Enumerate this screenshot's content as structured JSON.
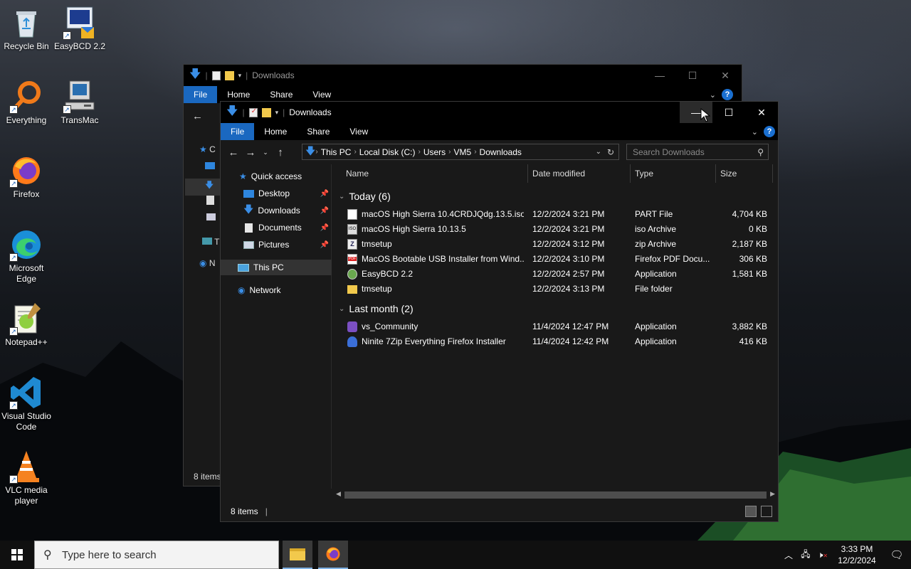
{
  "desktop": {
    "icons": [
      {
        "label": "Recycle Bin"
      },
      {
        "label": "EasyBCD 2.2"
      },
      {
        "label": "Everything"
      },
      {
        "label": "TransMac"
      },
      {
        "label": "Firefox"
      },
      {
        "label": "Microsoft Edge"
      },
      {
        "label": "Notepad++"
      },
      {
        "label": "Visual Studio Code"
      },
      {
        "label": "VLC media player"
      }
    ]
  },
  "back_window": {
    "title": "Downloads",
    "ribbon": {
      "file": "File",
      "home": "Home",
      "share": "Share",
      "view": "View"
    },
    "status": "8 items",
    "nav_peek": [
      "C",
      "T",
      "N"
    ]
  },
  "window": {
    "title": "Downloads",
    "ribbon": {
      "file": "File",
      "home": "Home",
      "share": "Share",
      "view": "View"
    },
    "breadcrumb": [
      "This PC",
      "Local Disk (C:)",
      "Users",
      "VM5",
      "Downloads"
    ],
    "search_placeholder": "Search Downloads",
    "nav": {
      "quick_access": "Quick access",
      "desktop": "Desktop",
      "downloads": "Downloads",
      "documents": "Documents",
      "pictures": "Pictures",
      "this_pc": "This PC",
      "network": "Network"
    },
    "columns": {
      "name": "Name",
      "date": "Date modified",
      "type": "Type",
      "size": "Size"
    },
    "groups": [
      {
        "label": "Today (6)",
        "files": [
          {
            "name": "macOS High Sierra 10.4CRDJQdg.13.5.iso...",
            "date": "12/2/2024 3:21 PM",
            "type": "PART File",
            "size": "4,704 KB",
            "icon": "part-file-icon"
          },
          {
            "name": "macOS High Sierra 10.13.5",
            "date": "12/2/2024 3:21 PM",
            "type": "iso Archive",
            "size": "0 KB",
            "icon": "iso-archive-icon"
          },
          {
            "name": "tmsetup",
            "date": "12/2/2024 3:12 PM",
            "type": "zip Archive",
            "size": "2,187 KB",
            "icon": "zip-archive-icon"
          },
          {
            "name": "MacOS Bootable USB Installer from Wind...",
            "date": "12/2/2024 3:10 PM",
            "type": "Firefox PDF Docu...",
            "size": "306 KB",
            "icon": "pdf-icon"
          },
          {
            "name": "EasyBCD 2.2",
            "date": "12/2/2024 2:57 PM",
            "type": "Application",
            "size": "1,581 KB",
            "icon": "easybcd-icon"
          },
          {
            "name": "tmsetup",
            "date": "12/2/2024 3:13 PM",
            "type": "File folder",
            "size": "",
            "icon": "folder-icon"
          }
        ]
      },
      {
        "label": "Last month (2)",
        "files": [
          {
            "name": "vs_Community",
            "date": "11/4/2024 12:47 PM",
            "type": "Application",
            "size": "3,882 KB",
            "icon": "visual-studio-icon"
          },
          {
            "name": "Ninite 7Zip Everything Firefox Installer",
            "date": "11/4/2024 12:42 PM",
            "type": "Application",
            "size": "416 KB",
            "icon": "ninite-icon"
          }
        ]
      }
    ],
    "status": "8 items"
  },
  "taskbar": {
    "search_placeholder": "Type here to search",
    "time": "3:33 PM",
    "date": "12/2/2024"
  },
  "colors": {
    "accent": "#1a68c0",
    "window_bg": "#191919",
    "titlebar_bg": "#000000",
    "folder_yellow": "#f2c94c"
  }
}
